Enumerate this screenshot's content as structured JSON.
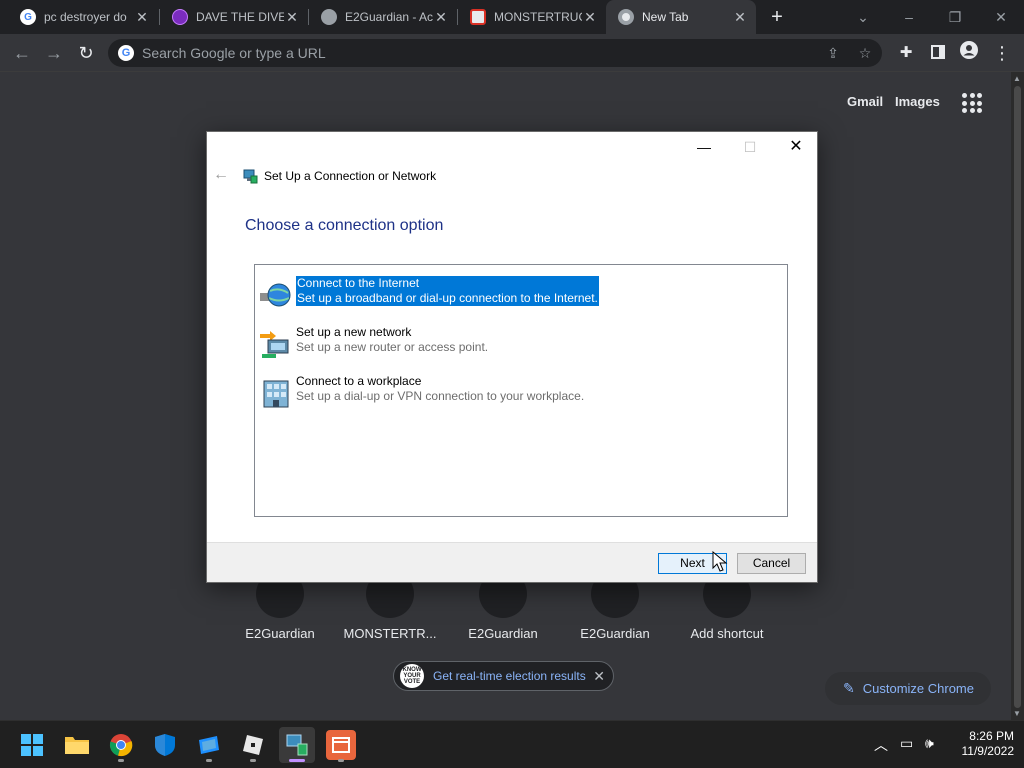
{
  "browser": {
    "tabs": [
      {
        "title": "pc destroyer do",
        "icon": "google-icon"
      },
      {
        "title": "DAVE THE DIVER",
        "icon": "dave-icon"
      },
      {
        "title": "E2Guardian - Ac",
        "icon": "globe-icon"
      },
      {
        "title": "MONSTERTRUC",
        "icon": "monstertruck-icon"
      },
      {
        "title": "New Tab",
        "icon": "chrome-icon",
        "active": true
      }
    ],
    "omnibox_placeholder": "Search Google or type a URL",
    "header_links": {
      "gmail": "Gmail",
      "images": "Images"
    },
    "shortcuts": [
      {
        "label": "E2Guardian"
      },
      {
        "label": "MONSTERTR..."
      },
      {
        "label": "E2Guardian"
      },
      {
        "label": "E2Guardian"
      },
      {
        "label": "Add shortcut"
      }
    ],
    "election_chip": "Get real-time election results",
    "election_logo": "KNOW YOUR VOTE",
    "customize_label": "Customize Chrome"
  },
  "dialog": {
    "title": "Set Up a Connection or Network",
    "heading": "Choose a connection option",
    "options": [
      {
        "title": "Connect to the Internet",
        "desc": "Set up a broadband or dial-up connection to the Internet.",
        "selected": true
      },
      {
        "title": "Set up a new network",
        "desc": "Set up a new router or access point."
      },
      {
        "title": "Connect to a workplace",
        "desc": "Set up a dial-up or VPN connection to your workplace."
      }
    ],
    "next_label": "Next",
    "cancel_label": "Cancel"
  },
  "taskbar": {
    "time": "8:26 PM",
    "date": "11/9/2022"
  },
  "colors": {
    "accent": "#0078d7",
    "chrome_bg": "#35363a",
    "tabstrip": "#202124",
    "link_blue": "#8ab4f8"
  }
}
